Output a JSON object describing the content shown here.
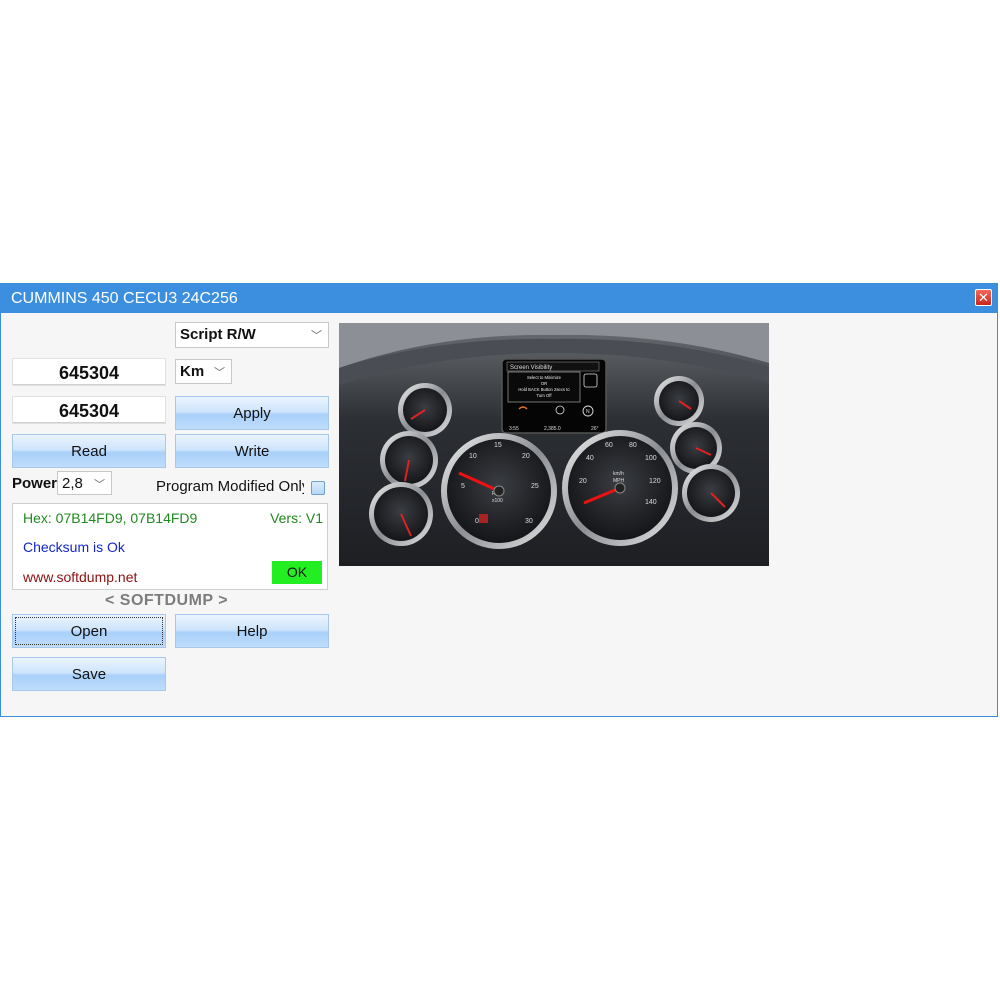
{
  "window": {
    "title": "CUMMINS 450 CECU3 24C256"
  },
  "controls": {
    "script_select": "Script R/W",
    "value_read": "645304",
    "value_write": "645304",
    "unit_select": "Km",
    "apply_label": "Apply",
    "read_label": "Read",
    "write_label": "Write",
    "power_label": "Power",
    "power_select": "2,8",
    "program_modified_label": "Program Modified Only",
    "program_modified_checked": false,
    "open_label": "Open",
    "help_label": "Help",
    "save_label": "Save"
  },
  "status": {
    "hex": "Hex: 07B14FD9, 07B14FD9",
    "vers": "Vers: V1",
    "checksum": "Checksum is Ok",
    "website": "www.softdump.net",
    "ok_badge": "OK"
  },
  "brand": "< SOFTDUMP >",
  "dashboard": {
    "screen_title": "Screen Visibility",
    "screen_line1": "Select to Minimize",
    "screen_line2": "OR",
    "screen_line3": "Hold BACK Button 2secs to",
    "screen_line4": "Turn Off",
    "time": "3:55",
    "odometer": "2,385.0",
    "temp": "26°",
    "rpm_label": "RPM",
    "rpm_unit": "x100",
    "speed_unit": "km/h",
    "speed_unit2": "MPH",
    "rpm_ticks": [
      "0",
      "5",
      "10",
      "15",
      "20",
      "25",
      "30"
    ],
    "speed_ticks": [
      "20",
      "40",
      "60",
      "80",
      "100",
      "120",
      "140"
    ]
  },
  "colors": {
    "titlebar": "#3c8fde",
    "hex_text": "#1f8a1f",
    "checksum_text": "#1427c6",
    "site_text": "#8b1010",
    "ok_badge": "#22ee22"
  }
}
